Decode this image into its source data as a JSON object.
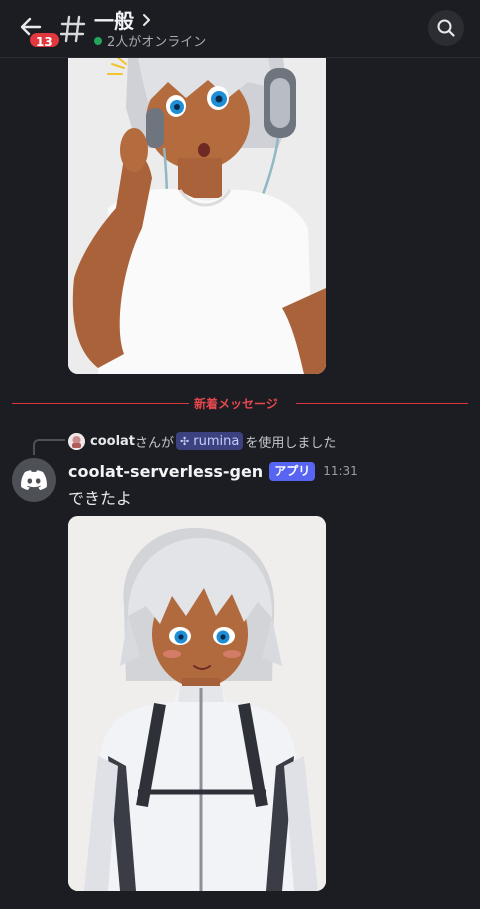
{
  "header": {
    "unread_badge": "13",
    "channel_name": "一般",
    "online_status": "2人がオンライン"
  },
  "divider": {
    "label": "新着メッセージ"
  },
  "command": {
    "user": "coolat",
    "middle": "さんが",
    "app_name": "rumina",
    "suffix": "を使用しました"
  },
  "message": {
    "author": "coolat-serverless-gen",
    "tag": "アプリ",
    "time": "11:31",
    "text": "できたよ"
  },
  "colors": {
    "accent": "#5865f2",
    "unread": "#e0383e",
    "online": "#23a55a"
  },
  "icons": [
    "back-arrow-icon",
    "hash-icon",
    "chevron-right-icon",
    "search-icon",
    "discord-logo-icon",
    "app-command-icon"
  ]
}
